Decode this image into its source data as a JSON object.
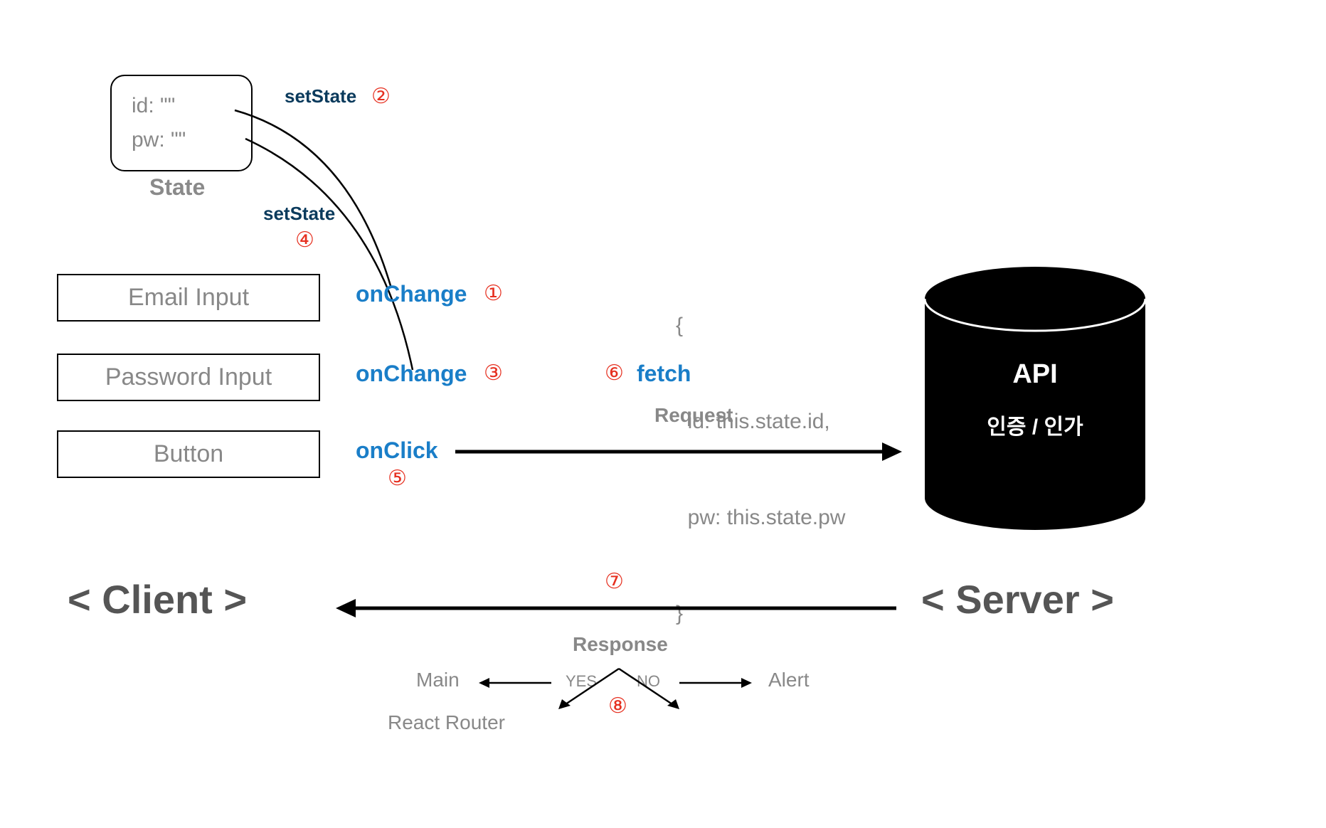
{
  "state_box": {
    "id_key": "id:",
    "id_value": "\"\"",
    "pw_key": "pw:",
    "pw_value": "\"\""
  },
  "labels": {
    "state": "State",
    "client_header": "< Client >",
    "server_header": "< Server >",
    "request": "Request",
    "response": "Response"
  },
  "inputs": {
    "email": "Email Input",
    "password": "Password Input",
    "button": "Button"
  },
  "handlers": {
    "onchange1": "onChange",
    "onchange2": "onChange",
    "onclick": "onClick",
    "setstate1": "setState",
    "setstate2": "setState",
    "fetch": "fetch"
  },
  "numbers": {
    "n1": "①",
    "n2": "②",
    "n3": "③",
    "n4": "④",
    "n5": "⑤",
    "n6": "⑥",
    "n7": "⑦",
    "n8": "⑧"
  },
  "payload": {
    "open": "{",
    "line1": "  id: this.state.id,",
    "line2": "  pw: this.state.pw",
    "close": "}"
  },
  "db": {
    "title": "API",
    "subtitle": "인증 / 인가"
  },
  "response_tree": {
    "yes": "YES",
    "no": "NO",
    "main": "Main",
    "alert": "Alert",
    "router": "React Router"
  }
}
